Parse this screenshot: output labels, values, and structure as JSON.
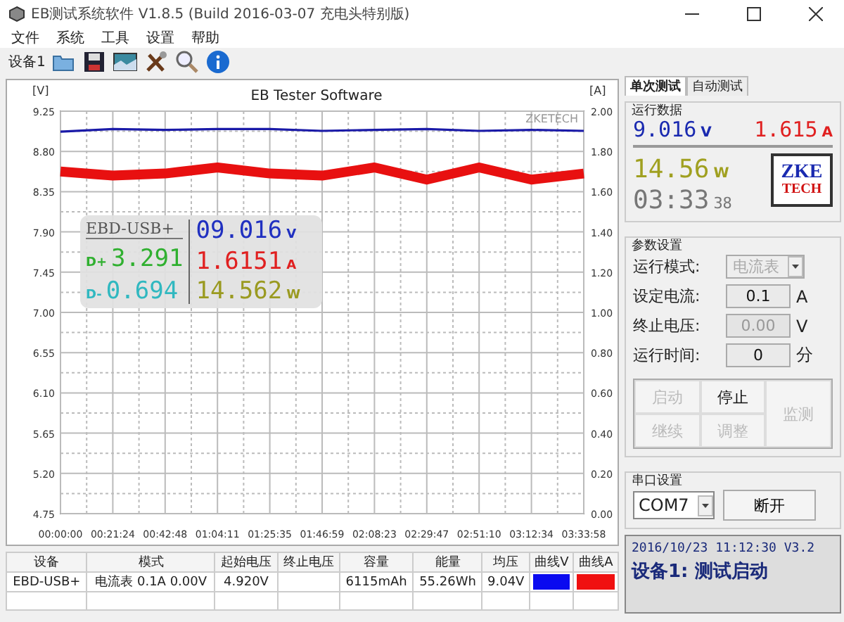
{
  "window": {
    "title": "EB测试系统软件 V1.8.5 (Build 2016-03-07 充电头特别版)"
  },
  "menu": [
    "文件",
    "系统",
    "工具",
    "设置",
    "帮助"
  ],
  "toolbar": {
    "device_label": "设备1"
  },
  "chart": {
    "watermark": "ZKETECH",
    "chart_data": {
      "type": "line",
      "title": "EB Tester Software",
      "ylabel": "[V]",
      "y2label": "[A]",
      "x": [
        "00:00:00",
        "00:21:24",
        "00:42:48",
        "01:04:11",
        "01:25:35",
        "01:46:59",
        "02:08:23",
        "02:29:47",
        "02:51:10",
        "03:12:34",
        "03:33:58"
      ],
      "grid": true,
      "ylim": [
        4.75,
        9.25
      ],
      "yticks": [
        4.75,
        {
          "value": 5.2,
          "label": "5.20"
        },
        5.65,
        {
          "value": 6.1,
          "label": "6.10"
        },
        6.55,
        {
          "value": 7,
          "label": "7.00"
        },
        7.45,
        {
          "value": 7.9,
          "label": "7.90"
        },
        8.35,
        {
          "value": 8.8,
          "label": "8.80"
        },
        9.25
      ],
      "y2lim": [
        0,
        2
      ],
      "y2ticks": [
        {
          "value": 0,
          "label": "0.00"
        },
        {
          "value": 0.2,
          "label": "0.20"
        },
        {
          "value": 0.4,
          "label": "0.40"
        },
        {
          "value": 0.6,
          "label": "0.60"
        },
        {
          "value": 0.8,
          "label": "0.80"
        },
        {
          "value": 1,
          "label": "1.00"
        },
        {
          "value": 1.2,
          "label": "1.20"
        },
        {
          "value": 1.4,
          "label": "1.40"
        },
        {
          "value": 1.6,
          "label": "1.60"
        },
        {
          "value": 1.8,
          "label": "1.80"
        },
        {
          "value": 2,
          "label": "2.00"
        }
      ],
      "series": [
        {
          "color": "#1a1aa8",
          "axis": "y",
          "values": [
            9.02,
            9.05,
            9.04,
            9.05,
            9.05,
            9.03,
            9.04,
            9.05,
            9.03,
            9.04,
            9.03
          ]
        },
        {
          "color": "#e81010",
          "axis": "y2",
          "values": [
            1.7,
            1.68,
            1.69,
            1.72,
            1.69,
            1.68,
            1.72,
            1.66,
            1.72,
            1.66,
            1.69
          ]
        }
      ]
    }
  },
  "overlay": {
    "device": "EBD-USB+",
    "dplus_label": "D+",
    "dplus": "3.291",
    "dminus_label": "D-",
    "dminus": "0.694",
    "voltage": "09.016",
    "voltage_unit": "V",
    "current": "1.6151",
    "current_unit": "A",
    "power": "14.562",
    "power_unit": "W"
  },
  "table": {
    "columns": [
      "设备",
      "模式",
      "起始电压",
      "终止电压",
      "容量",
      "能量",
      "均压",
      "曲线V",
      "曲线A"
    ],
    "rows": [
      {
        "device": "EBD-USB+",
        "mode": "电流表 0.1A 0.00V",
        "start_voltage": "4.920V",
        "capacity": "6115mAh",
        "energy": "55.26Wh",
        "avg_voltage": "9.04V",
        "swatches": [
          {
            "color": "#0a0af0"
          },
          {
            "color": "#f01010"
          }
        ]
      }
    ]
  },
  "tabs": [
    {
      "label": "单次测试",
      "selected": true
    },
    {
      "label": "自动测试",
      "selected": false
    }
  ],
  "run_data": {
    "title": "运行数据",
    "voltage": "9.016",
    "voltage_unit": "V",
    "current": "1.615",
    "current_unit": "A",
    "power": "14.56",
    "power_unit": "W",
    "time": "03:33",
    "seconds": "38",
    "logo_top": "ZKE",
    "logo_bottom": "TECH"
  },
  "params": {
    "title": "参数设置",
    "rows": [
      {
        "kind": "select",
        "label": "运行模式:",
        "value": "电流表",
        "disabled": true
      },
      {
        "kind": "input",
        "label": "设定电流:",
        "value": "0.1",
        "unit": "A",
        "disabled": false
      },
      {
        "kind": "input",
        "label": "终止电压:",
        "value": "0.00",
        "unit": "V",
        "disabled": true
      },
      {
        "kind": "input",
        "label": "运行时间:",
        "value": "0",
        "unit": "分",
        "disabled": false
      }
    ],
    "buttons": [
      {
        "label": "启动",
        "disabled": true
      },
      {
        "label": "停止",
        "disabled": false
      },
      {
        "label": "继续",
        "disabled": true
      },
      {
        "label": "调整",
        "disabled": true
      }
    ],
    "side_button": {
      "label": "监测",
      "disabled": true
    }
  },
  "serial": {
    "title": "串口设置",
    "port": "COM7",
    "button": "断开"
  },
  "status": {
    "line1": "2016/10/23 11:12:30  V3.2",
    "line2": "设备1: 测试启动"
  }
}
